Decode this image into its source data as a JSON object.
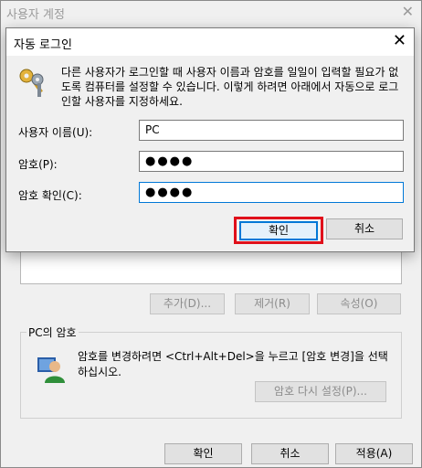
{
  "background_window": {
    "title": "사용자 계정",
    "close_glyph": "✕",
    "buttons": {
      "add": "추가(D)...",
      "remove": "제거(R)",
      "properties": "속성(O)"
    },
    "password_group": {
      "legend": "PC의 암호",
      "text": "암호를 변경하려면 <Ctrl+Alt+Del>을 누르고 [암호 변경]을 선택하십시오.",
      "reset_button": "암호 다시 설정(P)..."
    },
    "footer": {
      "ok": "확인",
      "cancel": "취소",
      "apply": "적용(A)"
    }
  },
  "dialog": {
    "title": "자동 로그인",
    "close_glyph": "✕",
    "description": "다른 사용자가 로그인할 때 사용자 이름과 암호를 일일이 입력할 필요가 없도록 컴퓨터를 설정할 수 있습니다. 이렇게 하려면 아래에서 자동으로 로그인할 사용자를 지정하세요.",
    "fields": {
      "username_label": "사용자 이름(U):",
      "username_value": "PC",
      "password_label": "암호(P):",
      "password_value": "●●●●",
      "confirm_label": "암호 확인(C):",
      "confirm_value": "●●●●"
    },
    "ok_label": "확인",
    "cancel_label": "취소"
  },
  "icons": {
    "keys": "keys-icon",
    "user": "user-icon"
  },
  "colors": {
    "highlight_border": "#e0101a",
    "focus_blue": "#0078d7"
  }
}
